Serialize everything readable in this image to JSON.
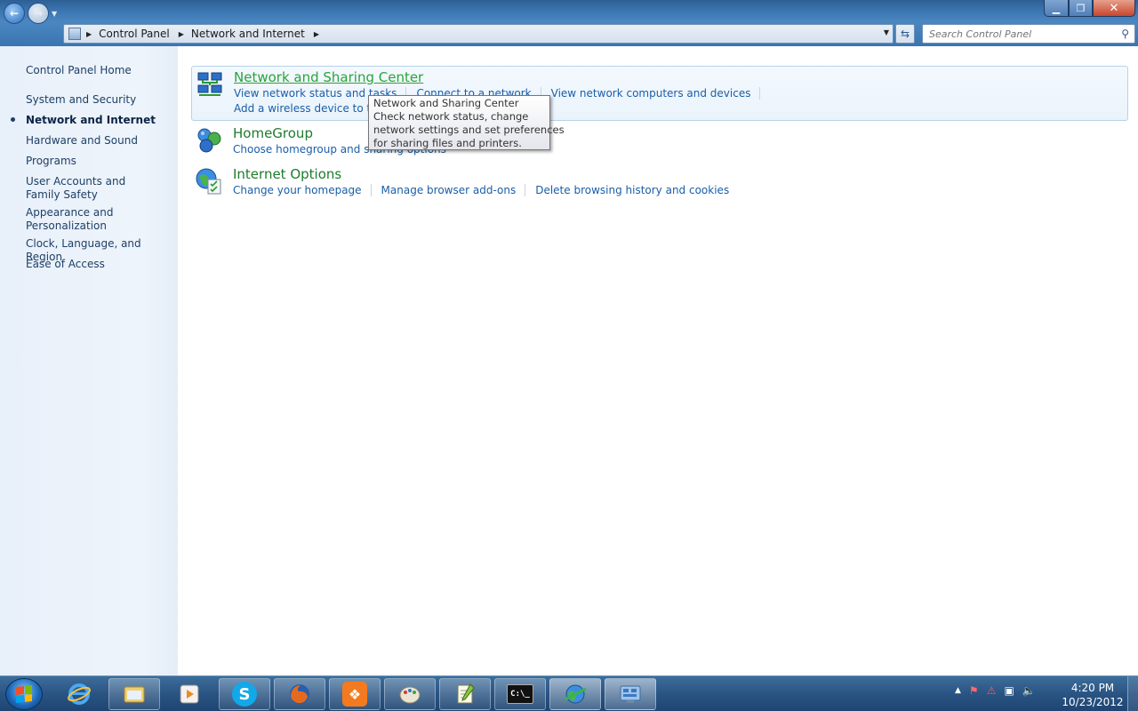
{
  "window": {
    "minimize_glyph": "▁",
    "maximize_glyph": "❐",
    "close_glyph": "✕"
  },
  "address_bar": {
    "breadcrumbs": [
      "Control Panel",
      "Network and Internet"
    ],
    "search_placeholder": "Search Control Panel"
  },
  "left_pane": {
    "items": [
      {
        "label": "Control Panel Home"
      },
      {
        "label": "System and Security"
      },
      {
        "label": "Network and Internet",
        "active": true
      },
      {
        "label": "Hardware and Sound"
      },
      {
        "label": "Programs"
      },
      {
        "label": "User Accounts and Family Safety"
      },
      {
        "label": "Appearance and Personalization"
      },
      {
        "label": "Clock, Language, and Region"
      },
      {
        "label": "Ease of Access"
      }
    ]
  },
  "categories": [
    {
      "title": "Network and Sharing Center",
      "icon": "network-sharing-icon",
      "tasks_row1": [
        "View network status and tasks",
        "Connect to a network",
        "View network computers and devices"
      ],
      "tasks_row2": [
        "Add a wireless device to the network"
      ]
    },
    {
      "title": "HomeGroup",
      "icon": "homegroup-icon",
      "tasks_row1": [
        "Choose homegroup and sharing options"
      ]
    },
    {
      "title": "Internet Options",
      "icon": "internet-options-icon",
      "tasks_row1": [
        "Change your homepage",
        "Manage browser add-ons",
        "Delete browsing history and cookies"
      ]
    }
  ],
  "tooltip": {
    "lines": [
      "Network and Sharing Center",
      "Check network status, change",
      "network settings and set preferences",
      "for sharing files and printers."
    ]
  },
  "taskbar": {
    "apps": [
      "internet-explorer-icon",
      "file-explorer-icon",
      "media-player-icon",
      "skype-icon",
      "firefox-icon",
      "xampp-icon",
      "paint-icon",
      "notepad-plus-plus-icon",
      "command-prompt-icon",
      "network-internet-icon",
      "control-panel-icon"
    ],
    "cmd_label": "C:\\_",
    "clock_time": "4:20 PM",
    "clock_date": "10/23/2012"
  },
  "colors": {
    "category_title": "#1e7b2e",
    "task_link": "#1a5ea8",
    "left_nav": "#1e3f66"
  }
}
